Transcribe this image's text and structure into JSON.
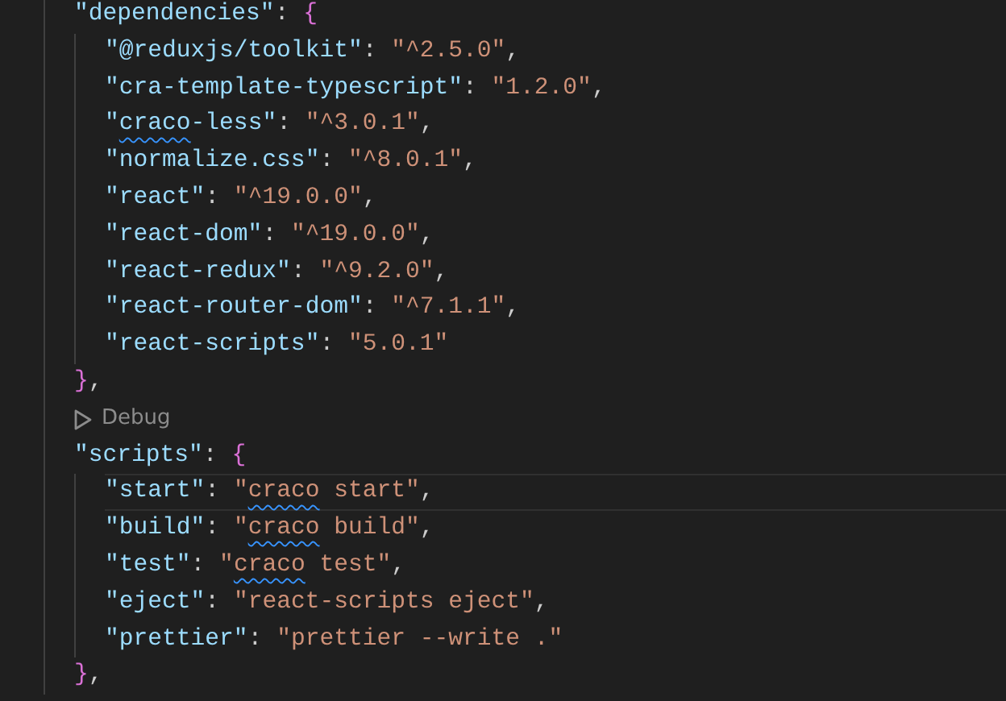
{
  "blocks": [
    {
      "header": [
        {
          "t": "\"dependencies\"",
          "kind": "key"
        },
        {
          "t": ": ",
          "kind": "punct"
        },
        {
          "t": "{",
          "kind": "brace"
        }
      ],
      "entries": [
        {
          "current_line": false,
          "tokens": [
            {
              "t": "\"@reduxjs/toolkit\"",
              "kind": "key"
            },
            {
              "t": ": ",
              "kind": "punct"
            },
            {
              "t": "\"^2.5.0\"",
              "kind": "string"
            },
            {
              "t": ",",
              "kind": "punct"
            }
          ]
        },
        {
          "current_line": false,
          "tokens": [
            {
              "t": "\"cra-template-typescript\"",
              "kind": "key"
            },
            {
              "t": ": ",
              "kind": "punct"
            },
            {
              "t": "\"1.2.0\"",
              "kind": "string"
            },
            {
              "t": ",",
              "kind": "punct"
            }
          ]
        },
        {
          "current_line": false,
          "tokens": [
            {
              "t": "\"",
              "kind": "key"
            },
            {
              "t": "craco",
              "kind": "key_misspelled"
            },
            {
              "t": "-less\"",
              "kind": "key"
            },
            {
              "t": ": ",
              "kind": "punct"
            },
            {
              "t": "\"^3.0.1\"",
              "kind": "string"
            },
            {
              "t": ",",
              "kind": "punct"
            }
          ]
        },
        {
          "current_line": false,
          "tokens": [
            {
              "t": "\"normalize.css\"",
              "kind": "key"
            },
            {
              "t": ": ",
              "kind": "punct"
            },
            {
              "t": "\"^8.0.1\"",
              "kind": "string"
            },
            {
              "t": ",",
              "kind": "punct"
            }
          ]
        },
        {
          "current_line": false,
          "tokens": [
            {
              "t": "\"react\"",
              "kind": "key"
            },
            {
              "t": ": ",
              "kind": "punct"
            },
            {
              "t": "\"^19.0.0\"",
              "kind": "string"
            },
            {
              "t": ",",
              "kind": "punct"
            }
          ]
        },
        {
          "current_line": false,
          "tokens": [
            {
              "t": "\"react-dom\"",
              "kind": "key"
            },
            {
              "t": ": ",
              "kind": "punct"
            },
            {
              "t": "\"^19.0.0\"",
              "kind": "string"
            },
            {
              "t": ",",
              "kind": "punct"
            }
          ]
        },
        {
          "current_line": false,
          "tokens": [
            {
              "t": "\"react-redux\"",
              "kind": "key"
            },
            {
              "t": ": ",
              "kind": "punct"
            },
            {
              "t": "\"^9.2.0\"",
              "kind": "string"
            },
            {
              "t": ",",
              "kind": "punct"
            }
          ]
        },
        {
          "current_line": false,
          "tokens": [
            {
              "t": "\"react-router-dom\"",
              "kind": "key"
            },
            {
              "t": ": ",
              "kind": "punct"
            },
            {
              "t": "\"^7.1.1\"",
              "kind": "string"
            },
            {
              "t": ",",
              "kind": "punct"
            }
          ]
        },
        {
          "current_line": false,
          "tokens": [
            {
              "t": "\"react-scripts\"",
              "kind": "key"
            },
            {
              "t": ": ",
              "kind": "punct"
            },
            {
              "t": "\"5.0.1\"",
              "kind": "string"
            }
          ]
        }
      ],
      "footer": [
        {
          "t": "}",
          "kind": "brace"
        },
        {
          "t": ",",
          "kind": "punct"
        }
      ]
    },
    {
      "codelens": "Debug",
      "header": [
        {
          "t": "\"scripts\"",
          "kind": "key"
        },
        {
          "t": ": ",
          "kind": "punct"
        },
        {
          "t": "{",
          "kind": "brace"
        }
      ],
      "entries": [
        {
          "current_line": true,
          "tokens": [
            {
              "t": "\"start\"",
              "kind": "key"
            },
            {
              "t": ": ",
              "kind": "punct"
            },
            {
              "t": "\"",
              "kind": "string"
            },
            {
              "t": "craco",
              "kind": "string_misspelled"
            },
            {
              "t": " start\"",
              "kind": "string"
            },
            {
              "t": ",",
              "kind": "punct"
            }
          ]
        },
        {
          "current_line": false,
          "tokens": [
            {
              "t": "\"build\"",
              "kind": "key"
            },
            {
              "t": ": ",
              "kind": "punct"
            },
            {
              "t": "\"",
              "kind": "string"
            },
            {
              "t": "craco",
              "kind": "string_misspelled"
            },
            {
              "t": " build\"",
              "kind": "string"
            },
            {
              "t": ",",
              "kind": "punct"
            }
          ]
        },
        {
          "current_line": false,
          "tokens": [
            {
              "t": "\"test\"",
              "kind": "key"
            },
            {
              "t": ": ",
              "kind": "punct"
            },
            {
              "t": "\"",
              "kind": "string"
            },
            {
              "t": "craco",
              "kind": "string_misspelled"
            },
            {
              "t": " test\"",
              "kind": "string"
            },
            {
              "t": ",",
              "kind": "punct"
            }
          ]
        },
        {
          "current_line": false,
          "tokens": [
            {
              "t": "\"eject\"",
              "kind": "key"
            },
            {
              "t": ": ",
              "kind": "punct"
            },
            {
              "t": "\"react-scripts eject\"",
              "kind": "string"
            },
            {
              "t": ",",
              "kind": "punct"
            }
          ]
        },
        {
          "current_line": false,
          "tokens": [
            {
              "t": "\"prettier\"",
              "kind": "key"
            },
            {
              "t": ": ",
              "kind": "punct"
            },
            {
              "t": "\"prettier --write .\"",
              "kind": "string"
            }
          ]
        }
      ],
      "footer": [
        {
          "t": "}",
          "kind": "brace"
        },
        {
          "t": ",",
          "kind": "punct"
        }
      ]
    }
  ]
}
